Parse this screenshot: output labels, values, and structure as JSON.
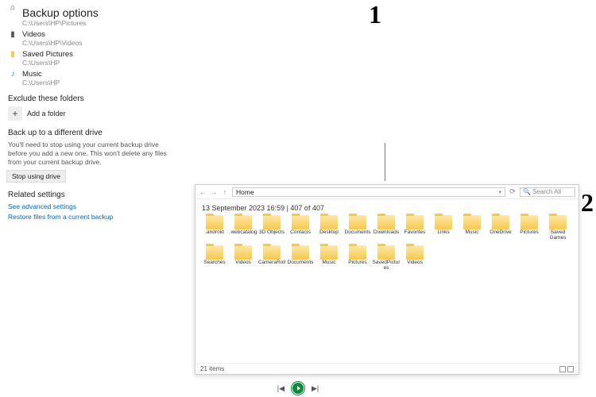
{
  "settings": {
    "title": "Backup options",
    "folders": [
      {
        "icon": "home-icon",
        "name": "",
        "path": "C:\\Users\\HP\\Pictures"
      },
      {
        "icon": "videos-icon",
        "name": "Videos",
        "path": "C:\\Users\\HP\\Videos"
      },
      {
        "icon": "folder-icon",
        "name": "Saved Pictures",
        "path": "C:\\Users\\HP"
      },
      {
        "icon": "music-icon",
        "name": "Music",
        "path": "C:\\Users\\HP"
      }
    ],
    "exclude_h": "Exclude these folders",
    "add_folder": "Add a folder",
    "diff_drive_h": "Back up to a different drive",
    "diff_drive_desc": "You'll need to stop using your current backup drive before you add a new one. This won't delete any files from your current backup drive.",
    "stop_btn": "Stop using drive",
    "related_h": "Related settings",
    "adv_link": "See advanced settings",
    "restore_link": "Restore files from a current backup"
  },
  "markers": {
    "one": "1",
    "two": "2"
  },
  "explorer": {
    "address": "Home",
    "search_placeholder": "Search All",
    "info_line": "13 September 2023 16:59   |   407 of 407",
    "status": "21 items",
    "items": [
      ".android",
      ".webcatalog",
      "3D Objects",
      "Contacts",
      "Desktop",
      "Documents",
      "Downloads",
      "Favorites",
      "Links",
      "Music",
      "OneDrive",
      "Pictures",
      "Saved Games",
      "Searches",
      "Videos",
      "CameraRoll",
      "Documents",
      "Music",
      "Pictures",
      "SavedPictures",
      "Videos"
    ]
  },
  "nav": {
    "prev": "|◀",
    "next": "▶|"
  }
}
